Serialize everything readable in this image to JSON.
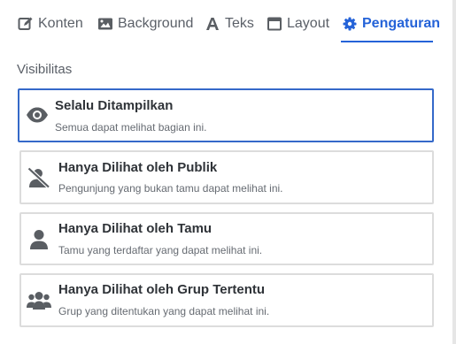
{
  "tabs": [
    {
      "label": "Konten",
      "icon": "edit-icon"
    },
    {
      "label": "Background",
      "icon": "image-icon"
    },
    {
      "label": "Teks",
      "icon": "font-icon"
    },
    {
      "label": "Layout",
      "icon": "window-icon"
    },
    {
      "label": "Pengaturan",
      "icon": "gear-icon",
      "active": true
    }
  ],
  "colors": {
    "accent": "#2563d8",
    "border": "#dcdcdc",
    "icon": "#5a5e63"
  },
  "visibility": {
    "label": "Visibilitas",
    "options": [
      {
        "title": "Selalu Ditampilkan",
        "desc": "Semua dapat melihat bagian ini.",
        "icon": "eye-icon",
        "selected": true
      },
      {
        "title": "Hanya Dilihat oleh Publik",
        "desc": "Pengunjung yang bukan tamu dapat melihat ini.",
        "icon": "user-slash-icon",
        "selected": false
      },
      {
        "title": "Hanya Dilihat oleh Tamu",
        "desc": "Tamu yang terdaftar yang dapat melihat ini.",
        "icon": "user-icon",
        "selected": false
      },
      {
        "title": "Hanya Dilihat oleh Grup Tertentu",
        "desc": "Grup yang ditentukan yang dapat melihat ini.",
        "icon": "users-icon",
        "selected": false
      }
    ]
  }
}
